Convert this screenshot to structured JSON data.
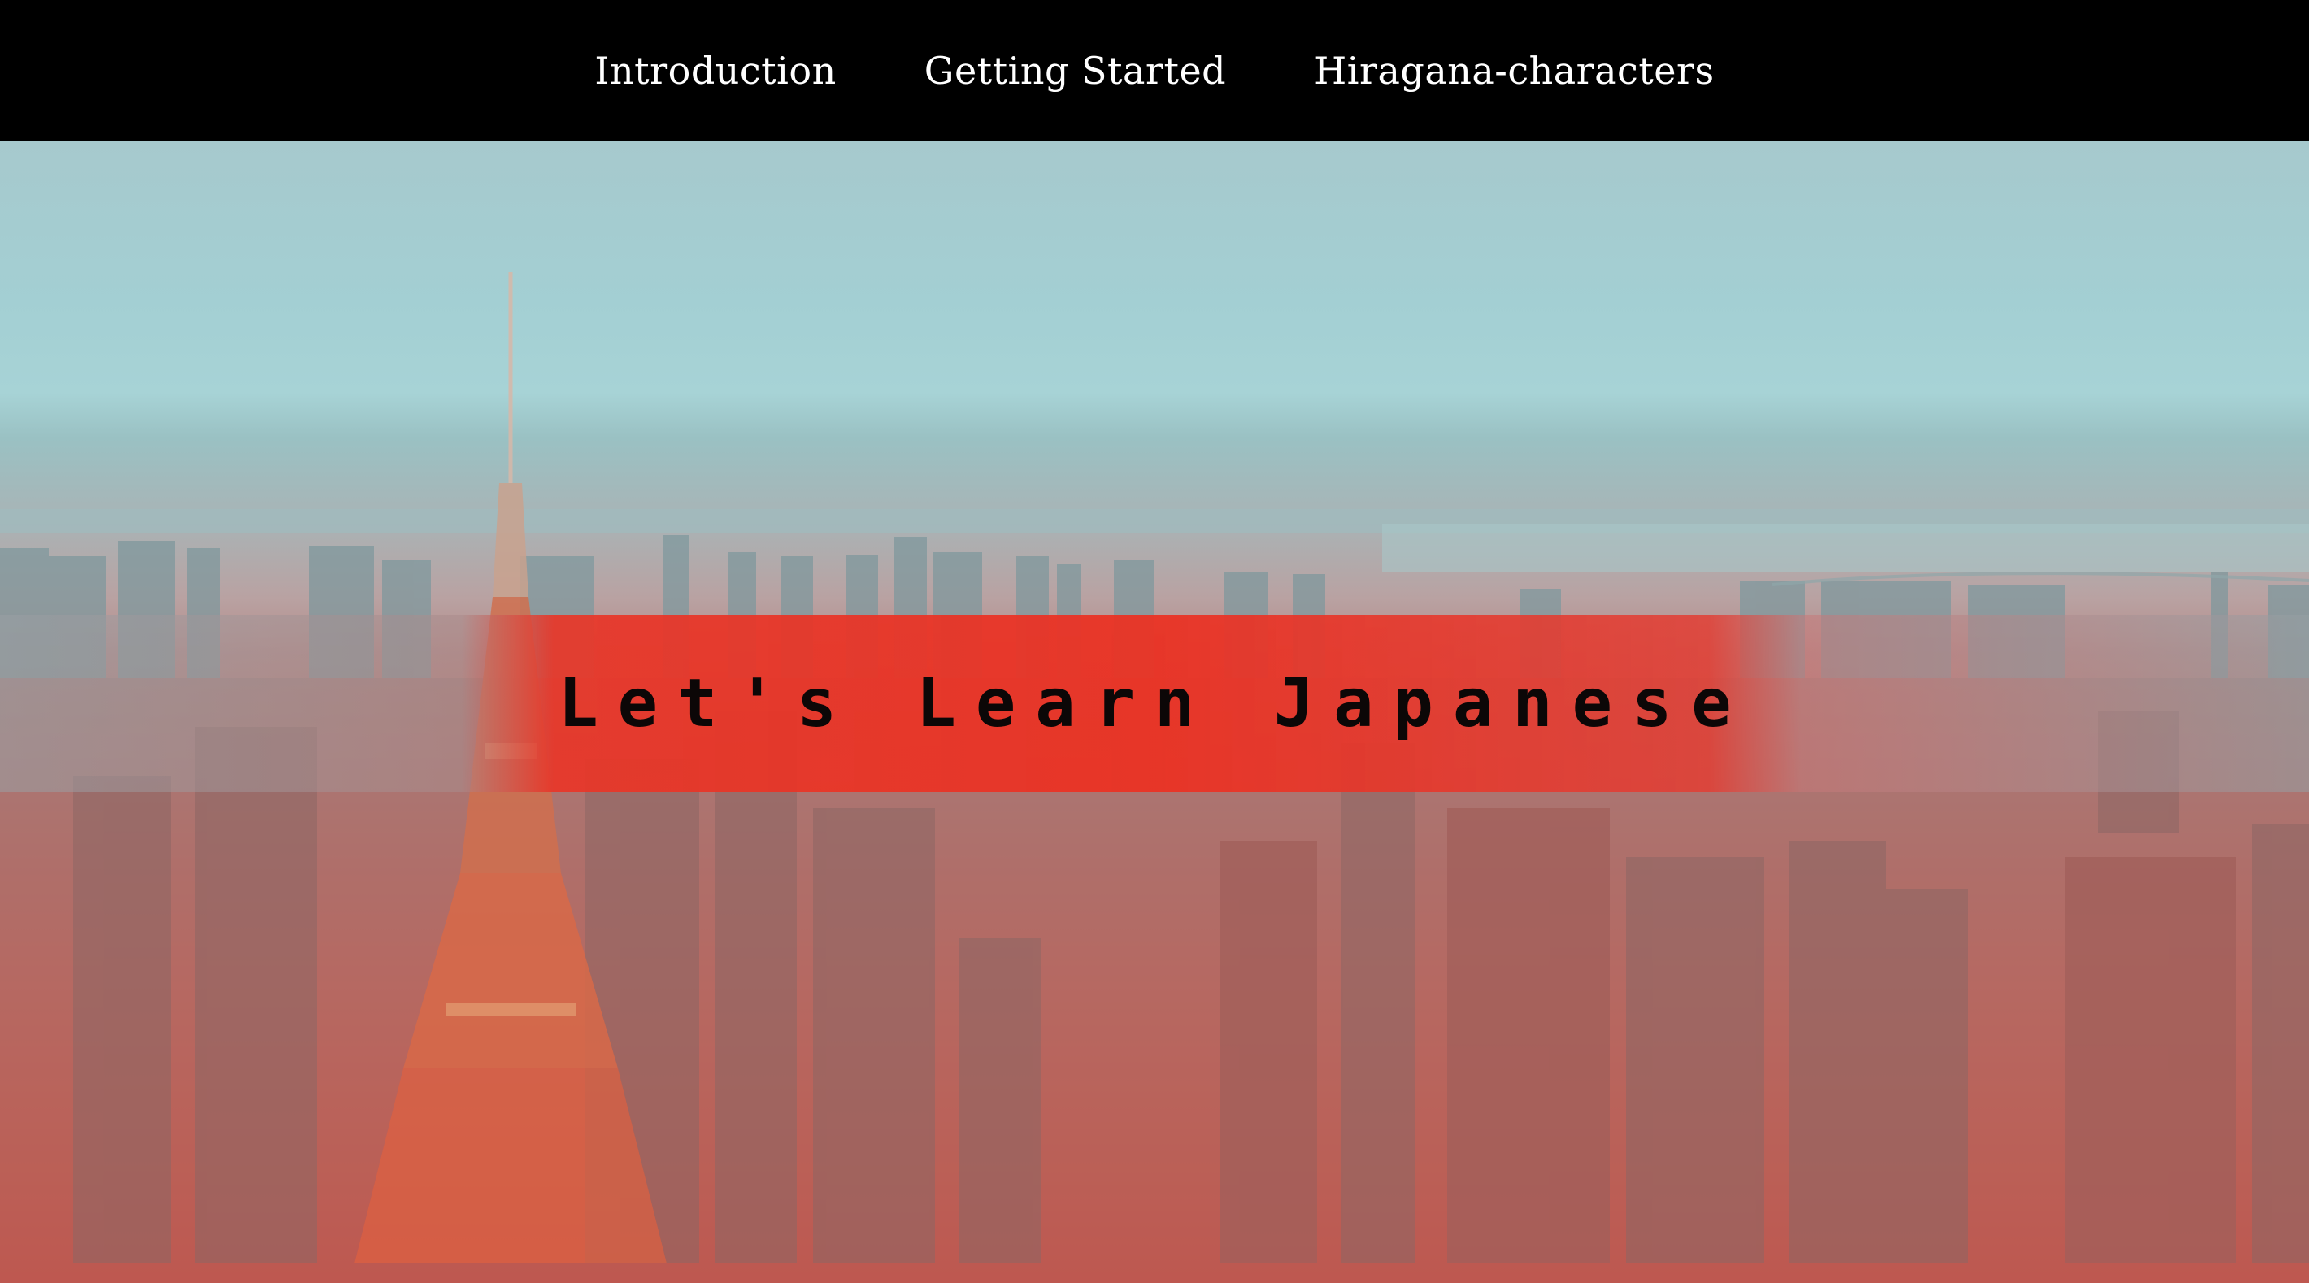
{
  "nav": {
    "items": [
      {
        "label": "Introduction"
      },
      {
        "label": "Getting Started"
      },
      {
        "label": "Hiragana-characters"
      }
    ]
  },
  "hero": {
    "title": "Let's Learn Japanese",
    "background_image": "Tokyo city skyline with Tokyo Tower, red gradient overlay"
  },
  "colors": {
    "nav_background": "#000000",
    "nav_text": "#ffffff",
    "accent_red": "#e8321f",
    "title_text": "#0c0707"
  }
}
